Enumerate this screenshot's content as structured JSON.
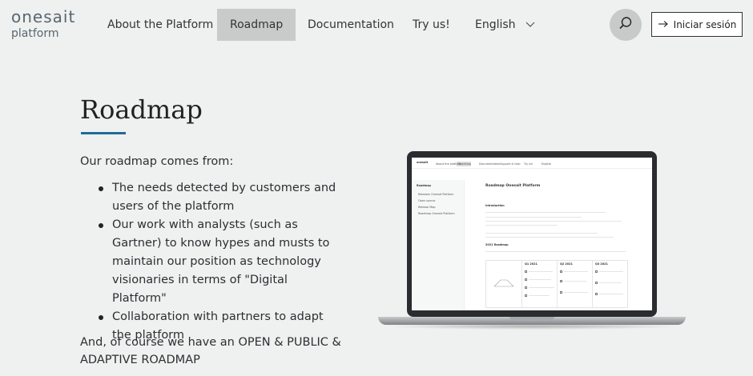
{
  "logo": {
    "line1": "onesait",
    "line2": "platform"
  },
  "nav": {
    "items": [
      {
        "label": "About the Platform"
      },
      {
        "label": "Roadmap"
      },
      {
        "label": "Documentation"
      },
      {
        "label": "Try us!"
      },
      {
        "label": "English"
      }
    ],
    "active_index": 1,
    "search_icon": "search-icon",
    "login": {
      "icon": "arrow-right-icon",
      "label": "Iniciar sesión"
    }
  },
  "page": {
    "title": "Roadmap",
    "intro": "Our roadmap comes from:",
    "bullets": [
      "The needs detected by customers and users of the platform",
      "Our work with analysts (such as Gartner) to know hypes and musts to maintain our position as technology visionaries in terms of \"Digital Platform\"",
      "Collaboration with partners to adapt the platform"
    ],
    "outro": "And, of course we have an OPEN & PUBLIC & ADAPTIVE ROADMAP"
  },
  "laptop_screen": {
    "nav": [
      "About the platform",
      "Roadmap",
      "Documentation",
      "Support & help",
      "Try us!",
      "English"
    ],
    "sidebar_title": "Roadmap",
    "sidebar_items": [
      "Releases Onesait Platform",
      "Open source",
      "Release Map",
      "Roadmap Onesait Platform"
    ],
    "doc_title": "Roadmap Onesait Platform",
    "section_intro": "Introduction",
    "section_year": "2021 Roadmap",
    "table_headers": [
      "Q1 2021",
      "Q2 2021",
      "Q3 2021"
    ]
  },
  "colors": {
    "accent": "#1f6a9a",
    "background": "#eef1ef",
    "nav_active": "#c9cbca"
  }
}
